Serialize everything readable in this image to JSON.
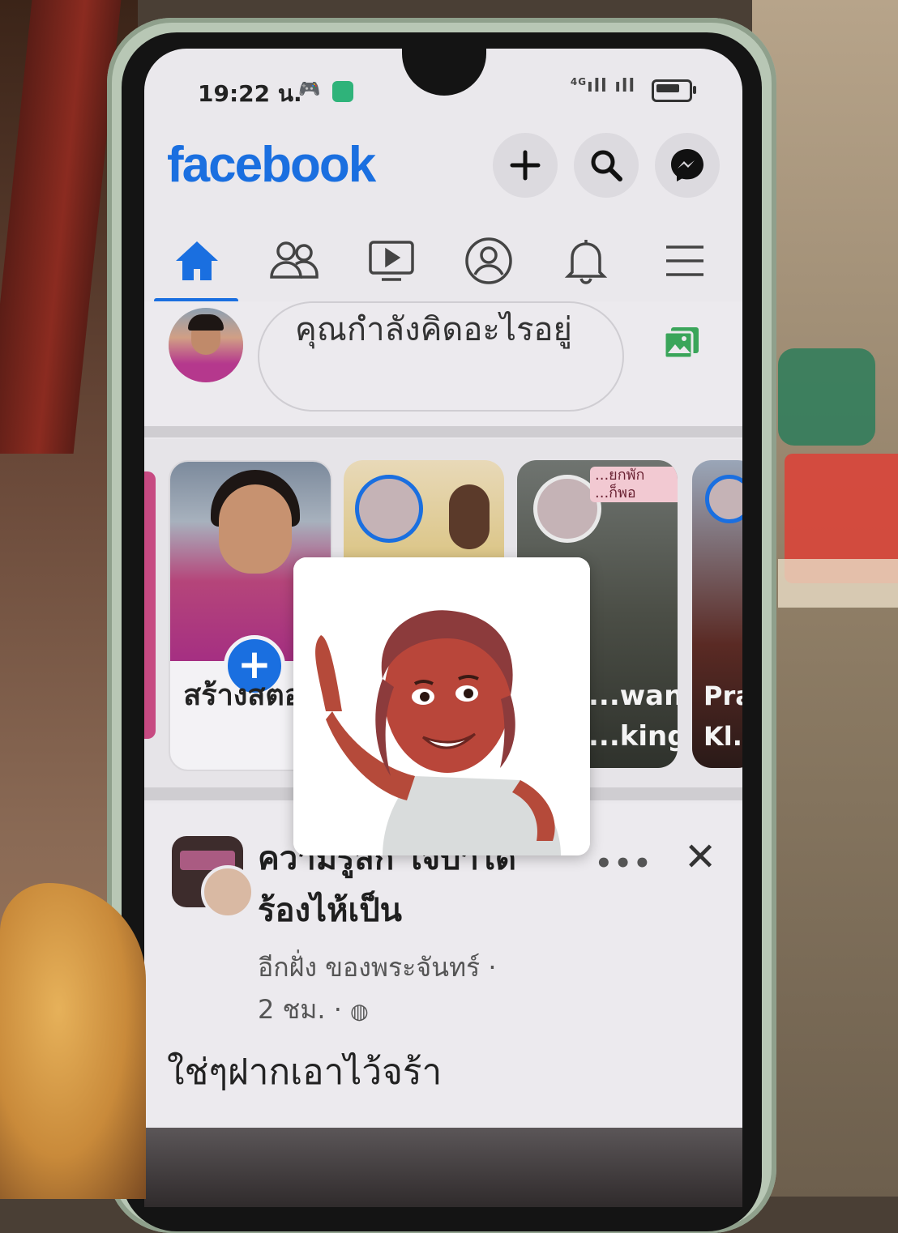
{
  "status_bar": {
    "time": "19:22 น.",
    "network": "4G",
    "signal": "ıll ıll"
  },
  "header": {
    "logo": "facebook",
    "icons": [
      "plus-icon",
      "search-icon",
      "messenger-icon"
    ],
    "brand_color": "#1a6fe0"
  },
  "nav": {
    "tabs": [
      "home-icon",
      "friends-icon",
      "watch-icon",
      "profile-icon",
      "notifications-icon",
      "menu-icon"
    ],
    "active": "home"
  },
  "composer": {
    "placeholder": "คุณกำลังคิดอะไรอยู่"
  },
  "stories": {
    "create_label": "สร้างสตอรี่",
    "items": [
      {
        "name": "",
        "badge": ""
      },
      {
        "name": "...wan ...king",
        "badge": "...ยกพัก ...ก็พอ"
      },
      {
        "name": "Pra... Kl...",
        "badge": ""
      }
    ]
  },
  "post": {
    "title": "ความรู้สึก ใจบาได ร้องไห้เป็น",
    "author": "อีกฝั่ง ของพระจันทร์ ·",
    "time": "2 ชม. · ",
    "body": "ใช่ๆฝากเอาไว้จร้า",
    "more": "•••",
    "close": "✕"
  }
}
